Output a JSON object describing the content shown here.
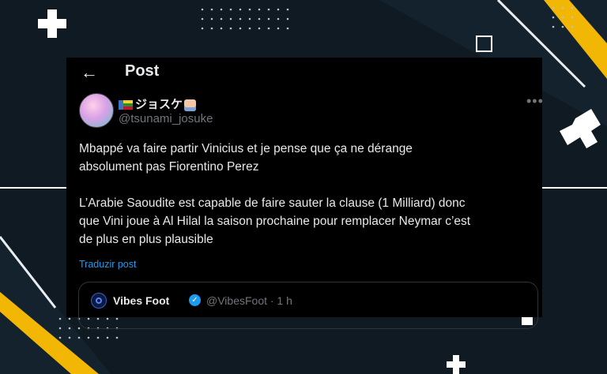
{
  "header": {
    "back_icon": "←",
    "title": "Post"
  },
  "author": {
    "name": "ジョスケ",
    "handle": "@tsunami_josuke"
  },
  "tweet": {
    "text": "Mbappé va faire partir Vinicius et je pense que ça ne dérange\nabsolument pas Fiorentino Perez\n\nL’Arabie Saoudite est capable de faire sauter la clause (1 Milliard) donc\nque Vini joue à Al Hilal la saison prochaine pour remplacer Neymar c’est\nde plus en plus plausible",
    "translate": "Traduzir post",
    "more_icon": "•••"
  },
  "quote": {
    "name": "Vibes Foot",
    "verified_icon": "✓",
    "handle": "@VibesFoot · 1 h"
  },
  "colors": {
    "background": "#0f1a22",
    "card": "#000000",
    "accent_link": "#1d9bf0",
    "decor_yellow": "#f2b705"
  }
}
